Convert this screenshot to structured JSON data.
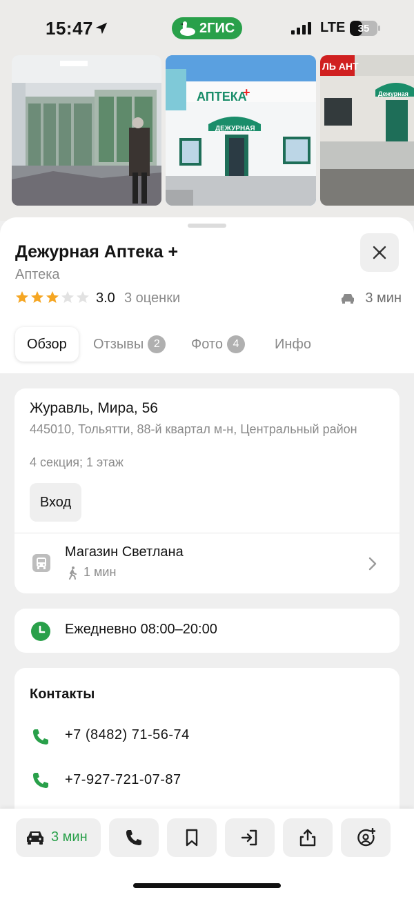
{
  "status_bar": {
    "time": "15:47",
    "app_name": "2ГИС",
    "network": "LTE",
    "battery": "35"
  },
  "place": {
    "title": "Дежурная Аптека +",
    "category": "Аптека",
    "rating_value": "3.0",
    "rating_stars": 3,
    "rating_count": "3 оценки",
    "eta": "3 мин"
  },
  "tabs": [
    {
      "label": "Обзор",
      "badge": ""
    },
    {
      "label": "Отзывы",
      "badge": "2"
    },
    {
      "label": "Фото",
      "badge": "4"
    },
    {
      "label": "Инфо",
      "badge": ""
    }
  ],
  "address": {
    "main": "Журавль, Мира, 56",
    "sub": "445010, Тольятти, 88-й квартал м-н, Центральный район",
    "floor": "4 секция; 1 этаж",
    "entrance_label": "Вход"
  },
  "transit": {
    "stop": "Магазин Светлана",
    "walk": "1 мин"
  },
  "hours": {
    "text": "Ежедневно 08:00–20:00"
  },
  "contacts": {
    "title": "Контакты",
    "phones": [
      "+7 (8482) 71-56-74",
      "+7-927-721-07-87"
    ]
  },
  "toolbar": {
    "route_label": "3 мин"
  },
  "photos": {
    "sign_1": "ДЕЖУРНАЯ",
    "sign_2": "АПТЕКА",
    "sign_3": "Дежурная",
    "sign_4": "ЛЬ АНТ"
  },
  "colors": {
    "accent": "#29a04a",
    "star": "#f5a623",
    "muted": "#8a8a8a"
  },
  "icons": [
    "location-arrow-icon",
    "goose-icon",
    "signal-icon",
    "battery-icon",
    "close-icon",
    "car-icon",
    "bus-stop-icon",
    "walk-icon",
    "chevron-right-icon",
    "clock-icon",
    "phone-icon",
    "bookmark-icon",
    "enter-icon",
    "share-icon",
    "add-contact-icon"
  ]
}
